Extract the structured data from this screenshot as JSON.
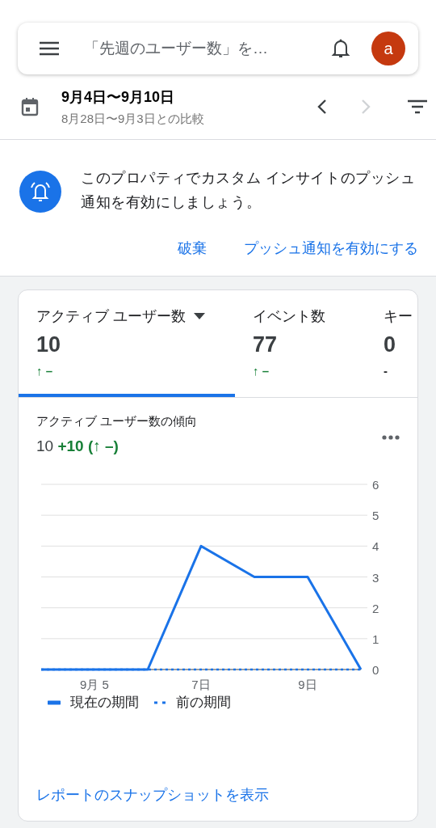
{
  "app_bar": {
    "search_text": "「先週のユーザー数」を…",
    "avatar_letter": "a"
  },
  "date_range": {
    "title": "9月4日〜9月10日",
    "comparison": "8月28日〜9月3日との比較",
    "next_disabled": true
  },
  "notice": {
    "message": "このプロパティでカスタム インサイトのプッシュ通知を有効にしましょう。",
    "actions": [
      "破棄",
      "プッシュ通知を有効にする"
    ]
  },
  "metric_tabs": [
    {
      "label": "アクティブ ユーザー数",
      "selected": true,
      "dropdown": true,
      "value": "10",
      "change": {
        "arrow": "↑",
        "text": "–"
      }
    },
    {
      "label": "イベント数",
      "selected": false,
      "dropdown": false,
      "value": "77",
      "change": {
        "arrow": "↑",
        "text": "–"
      }
    },
    {
      "label": "キー",
      "selected": false,
      "dropdown": false,
      "value": "0",
      "change": {
        "text": "-"
      }
    }
  ],
  "trend_card": {
    "title": "アクティブ ユーザー数の傾向",
    "total": "10",
    "delta": "+10 (↑ –)",
    "chart_data": {
      "type": "line",
      "categories": [
        null,
        "9月 5",
        null,
        "7日",
        null,
        "9日",
        null
      ],
      "ylim": [
        0,
        6
      ],
      "yticks": [
        0,
        1,
        2,
        3,
        4,
        5,
        6
      ],
      "grid": true,
      "series": [
        {
          "name": "現在の期間",
          "color": "#1a73e8",
          "line_style": "solid",
          "values": [
            0,
            0,
            0,
            4,
            3,
            3,
            0
          ]
        },
        {
          "name": "前の期間",
          "color": "#1a73e8",
          "line_style": "dotted",
          "values": [
            0,
            0,
            0,
            0,
            0,
            0,
            0
          ]
        }
      ]
    },
    "link": "レポートのスナップショットを表示"
  }
}
